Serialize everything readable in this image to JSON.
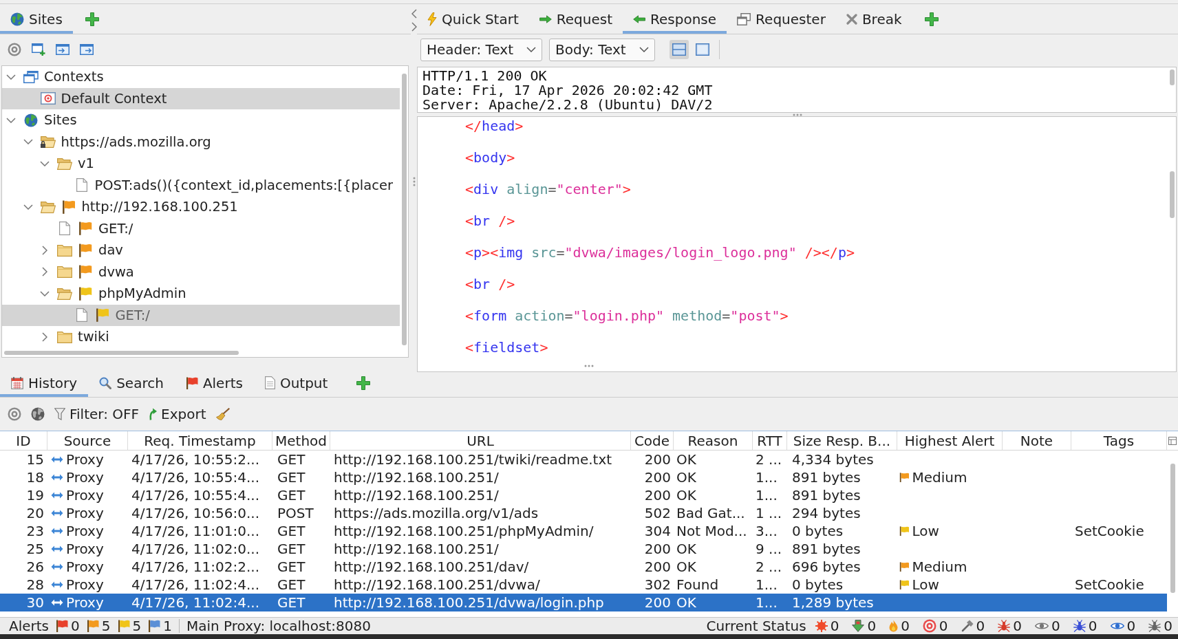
{
  "sites_panel": {
    "tabs": [
      {
        "label": "Sites",
        "selected": true
      }
    ],
    "tree": [
      {
        "label": "Contexts",
        "kind": "contexts",
        "expanded": true,
        "selected": false,
        "highlighted": false,
        "children": [
          {
            "label": "Default Context",
            "kind": "context",
            "selected": false,
            "highlighted": true
          }
        ]
      },
      {
        "label": "Sites",
        "kind": "sites",
        "expanded": true,
        "selected": false,
        "highlighted": false,
        "children": [
          {
            "label": "https://ads.mozilla.org",
            "kind": "secure-folder",
            "expanded": true,
            "selected": false,
            "highlighted": false,
            "children": [
              {
                "label": "v1",
                "kind": "folder",
                "expanded": true,
                "selected": false,
                "highlighted": false,
                "children": [
                  {
                    "label": "POST:ads()({context_id,placements:[{placer",
                    "kind": "file",
                    "selected": false,
                    "highlighted": false
                  }
                ]
              }
            ]
          },
          {
            "label": "http://192.168.100.251",
            "kind": "folder",
            "color": "#f39a1e",
            "expanded": true,
            "selected": false,
            "highlighted": false,
            "children": [
              {
                "label": "GET:/",
                "kind": "file",
                "color": "#f39a1e",
                "selected": false,
                "highlighted": false
              },
              {
                "label": "dav",
                "kind": "folder",
                "color": "#f39a1e",
                "expanded": false,
                "selected": false,
                "highlighted": false
              },
              {
                "label": "dvwa",
                "kind": "folder",
                "color": "#f39a1e",
                "expanded": false,
                "selected": false,
                "highlighted": false
              },
              {
                "label": "phpMyAdmin",
                "kind": "folder",
                "color": "#f0c419",
                "expanded": true,
                "selected": false,
                "highlighted": false,
                "children": [
                  {
                    "label": "GET:/",
                    "kind": "file",
                    "color": "#f0c419",
                    "selected": true,
                    "highlighted": false
                  }
                ]
              },
              {
                "label": "twiki",
                "kind": "folder",
                "expanded": false,
                "selected": false,
                "highlighted": false
              }
            ]
          }
        ]
      }
    ]
  },
  "message_panel": {
    "tabs": [
      {
        "label": "Quick Start",
        "selected": false
      },
      {
        "label": "Request",
        "selected": false
      },
      {
        "label": "Response",
        "selected": true
      },
      {
        "label": "Requester",
        "selected": false
      },
      {
        "label": "Break",
        "selected": false
      }
    ],
    "header_format": "Header: Text",
    "body_format": "Body: Text",
    "view_toggles": [
      {
        "selected": true
      },
      {
        "selected": false
      }
    ],
    "header_lines": [
      "HTTP/1.1 200 OK",
      "Date: Fri, 17 Apr 2026 20:02:42 GMT",
      "Server: Apache/2.2.8 (Ubuntu) DAV/2"
    ],
    "body_lines": [
      {
        "tokens": [
          {
            "kind": "punct",
            "text": "</"
          },
          {
            "kind": "tag",
            "text": "head"
          },
          {
            "kind": "punct",
            "text": ">"
          }
        ]
      },
      {
        "tokens": [
          {
            "kind": "punct",
            "text": "<"
          },
          {
            "kind": "tag",
            "text": "body"
          },
          {
            "kind": "punct",
            "text": ">"
          }
        ]
      },
      {
        "tokens": [
          {
            "kind": "punct",
            "text": "<"
          },
          {
            "kind": "tag",
            "text": "div"
          },
          {
            "kind": "attr",
            "text": " align"
          },
          {
            "kind": "eq",
            "text": "="
          },
          {
            "kind": "value",
            "text": "\"center\""
          },
          {
            "kind": "punct",
            "text": ">"
          }
        ]
      },
      {
        "tokens": [
          {
            "kind": "punct",
            "text": "<"
          },
          {
            "kind": "tag",
            "text": "br"
          },
          {
            "kind": "punct",
            "text": " />"
          }
        ]
      },
      {
        "tokens": [
          {
            "kind": "punct",
            "text": "<"
          },
          {
            "kind": "tag",
            "text": "p"
          },
          {
            "kind": "punct",
            "text": "><"
          },
          {
            "kind": "tag",
            "text": "img"
          },
          {
            "kind": "attr",
            "text": " src"
          },
          {
            "kind": "eq",
            "text": "="
          },
          {
            "kind": "value",
            "text": "\"dvwa/images/login_logo.png\""
          },
          {
            "kind": "punct",
            "text": " /></"
          },
          {
            "kind": "tag",
            "text": "p"
          },
          {
            "kind": "punct",
            "text": ">"
          }
        ]
      },
      {
        "tokens": [
          {
            "kind": "punct",
            "text": "<"
          },
          {
            "kind": "tag",
            "text": "br"
          },
          {
            "kind": "punct",
            "text": " />"
          }
        ]
      },
      {
        "tokens": [
          {
            "kind": "punct",
            "text": "<"
          },
          {
            "kind": "tag",
            "text": "form"
          },
          {
            "kind": "attr",
            "text": " action"
          },
          {
            "kind": "eq",
            "text": "="
          },
          {
            "kind": "value",
            "text": "\"login.php\""
          },
          {
            "kind": "attr",
            "text": " method"
          },
          {
            "kind": "eq",
            "text": "="
          },
          {
            "kind": "value",
            "text": "\"post\""
          },
          {
            "kind": "punct",
            "text": ">"
          }
        ]
      },
      {
        "tokens": [
          {
            "kind": "punct",
            "text": "<"
          },
          {
            "kind": "tag",
            "text": "fieldset"
          },
          {
            "kind": "punct",
            "text": ">"
          }
        ]
      }
    ]
  },
  "history_panel": {
    "tabs": [
      {
        "label": "History",
        "selected": true
      },
      {
        "label": "Search",
        "selected": false
      },
      {
        "label": "Alerts",
        "selected": false
      },
      {
        "label": "Output",
        "selected": false
      }
    ],
    "filter": "Filter: OFF",
    "export": "Export",
    "table": {
      "columns": [
        "ID",
        "Source",
        "Req. Timestamp",
        "Method",
        "URL",
        "Code",
        "Reason",
        "RTT",
        "Size Resp. B...",
        "Highest Alert",
        "Note",
        "Tags"
      ],
      "rows": [
        {
          "id": "15",
          "source": "Proxy",
          "timestamp": "4/17/26, 10:55:2...",
          "method": "GET",
          "url": "http://192.168.100.251/twiki/readme.txt",
          "code": "200",
          "reason": "OK",
          "rtt": "2 ...",
          "size": "4,334 bytes",
          "selected": false
        },
        {
          "id": "18",
          "source": "Proxy",
          "timestamp": "4/17/26, 10:55:4...",
          "method": "GET",
          "url": "http://192.168.100.251/",
          "code": "200",
          "reason": "OK",
          "rtt": "1...",
          "size": "891 bytes",
          "highest_alert": {
            "label": "Medium",
            "color": "#f39a1e"
          },
          "selected": false
        },
        {
          "id": "19",
          "source": "Proxy",
          "timestamp": "4/17/26, 10:55:4...",
          "method": "GET",
          "url": "http://192.168.100.251/",
          "code": "200",
          "reason": "OK",
          "rtt": "1...",
          "size": "891 bytes",
          "selected": false
        },
        {
          "id": "20",
          "source": "Proxy",
          "timestamp": "4/17/26, 10:56:0...",
          "method": "POST",
          "url": "https://ads.mozilla.org/v1/ads",
          "code": "502",
          "reason": "Bad Gat...",
          "rtt": "1 ...",
          "size": "294 bytes",
          "selected": false
        },
        {
          "id": "23",
          "source": "Proxy",
          "timestamp": "4/17/26, 11:01:0...",
          "method": "GET",
          "url": "http://192.168.100.251/phpMyAdmin/",
          "code": "304",
          "reason": "Not Mod...",
          "rtt": "3...",
          "size": "0 bytes",
          "highest_alert": {
            "label": "Low",
            "color": "#f0c419"
          },
          "tags": "SetCookie",
          "selected": false
        },
        {
          "id": "25",
          "source": "Proxy",
          "timestamp": "4/17/26, 11:02:0...",
          "method": "GET",
          "url": "http://192.168.100.251/",
          "code": "200",
          "reason": "OK",
          "rtt": "9 ...",
          "size": "891 bytes",
          "selected": false
        },
        {
          "id": "26",
          "source": "Proxy",
          "timestamp": "4/17/26, 11:02:2...",
          "method": "GET",
          "url": "http://192.168.100.251/dav/",
          "code": "200",
          "reason": "OK",
          "rtt": "2 ...",
          "size": "696 bytes",
          "highest_alert": {
            "label": "Medium",
            "color": "#f39a1e"
          },
          "selected": false
        },
        {
          "id": "28",
          "source": "Proxy",
          "timestamp": "4/17/26, 11:02:4...",
          "method": "GET",
          "url": "http://192.168.100.251/dvwa/",
          "code": "302",
          "reason": "Found",
          "rtt": "1...",
          "size": "0 bytes",
          "highest_alert": {
            "label": "Low",
            "color": "#f0c419"
          },
          "tags": "SetCookie",
          "selected": false
        },
        {
          "id": "30",
          "source": "Proxy",
          "timestamp": "4/17/26, 11:02:4...",
          "method": "GET",
          "url": "http://192.168.100.251/dvwa/login.php",
          "code": "200",
          "reason": "OK",
          "rtt": "1...",
          "size": "1,289 bytes",
          "selected": true
        }
      ]
    }
  },
  "status_bar": {
    "alerts_label": "Alerts",
    "alert_counts": [
      {
        "color": "#e8412c",
        "count": "0"
      },
      {
        "color": "#f39a1e",
        "count": "5"
      },
      {
        "color": "#f0c419",
        "count": "5"
      },
      {
        "color": "#5b8fd6",
        "count": "1"
      }
    ],
    "proxy": "Main Proxy: localhost:8080",
    "status_label": "Current Status",
    "status_counts": [
      "0",
      "0",
      "0",
      "0",
      "0",
      "0",
      "0",
      "0",
      "0",
      "0"
    ]
  }
}
